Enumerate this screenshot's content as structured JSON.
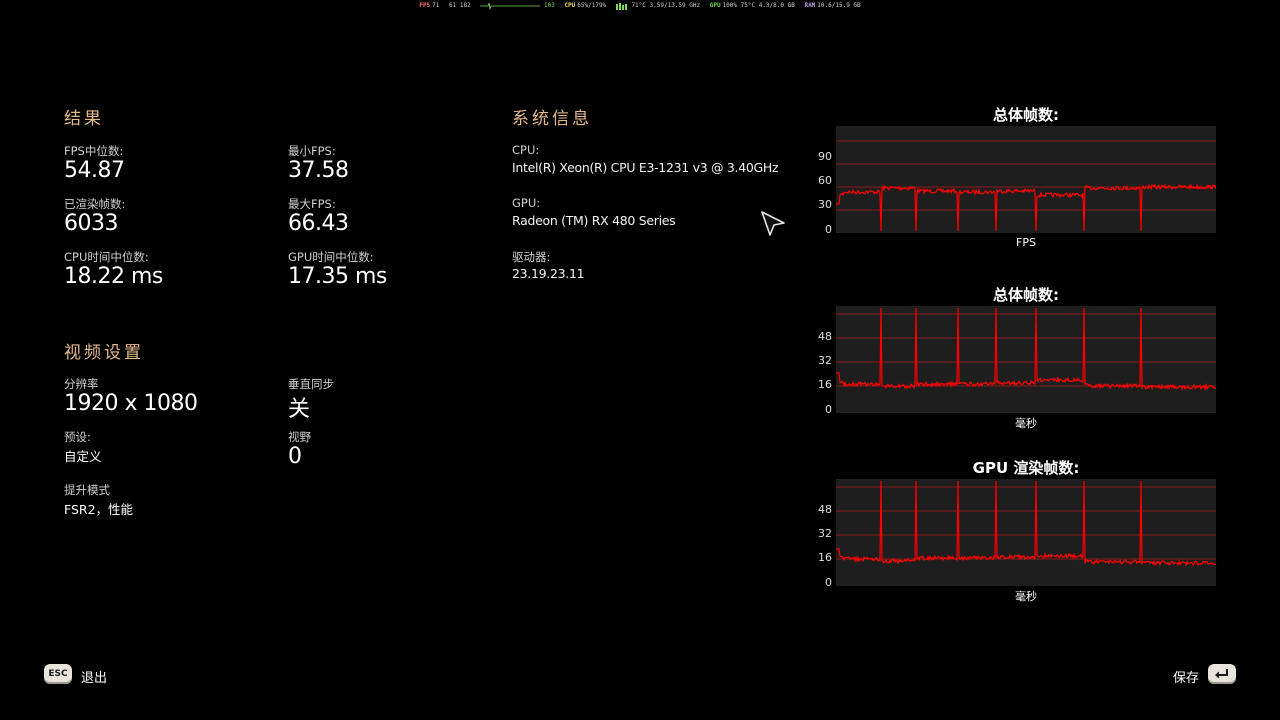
{
  "overlay": {
    "fps_key": "FPS",
    "fps_val": "71",
    "frame_vals": "61 182",
    "fps_small": "103",
    "cpu_key": "CPU",
    "cpu_val": "65%/179%",
    "temp_val": "71°C",
    "clock_val": "3.59/13.59 GHz",
    "gpu_key": "GPU",
    "gpu_val": "100% 75°C",
    "vram_val": "4.3/8.0 GB",
    "ram_key": "RAM",
    "ram_val": "10.6/15.9 GB",
    "colors": {
      "fps": "#ff6b6b",
      "cpu": "#ffd966",
      "gpu": "#7ed957",
      "ram": "#b39ddb"
    }
  },
  "results": {
    "title": "结果",
    "median_fps_label": "FPS中位数:",
    "median_fps": "54.87",
    "min_fps_label": "最小FPS:",
    "min_fps": "37.58",
    "frames_label": "已渲染帧数:",
    "frames": "6033",
    "max_fps_label": "最大FPS:",
    "max_fps": "66.43",
    "cpu_time_label": "CPU时间中位数:",
    "cpu_time": "18.22 ms",
    "gpu_time_label": "GPU时间中位数:",
    "gpu_time": "17.35 ms"
  },
  "video": {
    "title": "视频设置",
    "resolution_label": "分辨率",
    "resolution": "1920 x 1080",
    "vsync_label": "垂直同步",
    "vsync": "关",
    "preset_label": "预设:",
    "preset": "自定义",
    "fov_label": "视野",
    "fov": "0",
    "upscale_label": "提升模式",
    "upscale": "FSR2，性能"
  },
  "system": {
    "title": "系统信息",
    "cpu_label": "CPU:",
    "cpu": "Intel(R) Xeon(R) CPU E3-1231 v3 @ 3.40GHz",
    "gpu_label": "GPU:",
    "gpu": "Radeon (TM) RX 480 Series",
    "driver_label": "驱动器:",
    "driver": "23.19.23.11"
  },
  "charts": {
    "fps": {
      "title": "总体帧数:",
      "xlabel": "FPS",
      "ticks": [
        "90",
        "60",
        "30",
        "0"
      ]
    },
    "frametime": {
      "title": "总体帧数:",
      "xlabel": "毫秒",
      "ticks": [
        "48",
        "32",
        "16",
        "0"
      ]
    },
    "gputime": {
      "title": "GPU 渲染帧数:",
      "xlabel": "毫秒",
      "ticks": [
        "48",
        "32",
        "16",
        "0"
      ]
    },
    "line_color": "#ff0000",
    "grid_color": "#8b1a1a",
    "bg_color": "#1e1e1e"
  },
  "footer": {
    "esc_key": "ESC",
    "exit_label": "退出",
    "save_label": "保存",
    "enter_icon": "enter-key-icon"
  }
}
